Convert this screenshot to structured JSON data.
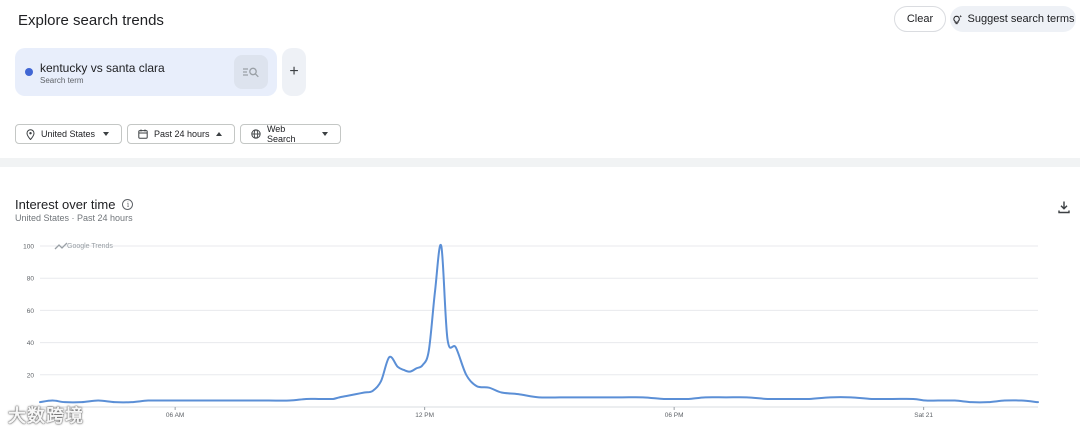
{
  "header": {
    "title": "Explore search trends",
    "clear_label": "Clear",
    "suggest_label": "Suggest search terms"
  },
  "term": {
    "text": "kentucky vs santa clara",
    "subtitle": "Search term",
    "color": "#4066d4",
    "add_symbol": "+"
  },
  "filters": {
    "region": "United States",
    "time": "Past 24 hours",
    "property": "Web Search"
  },
  "panel": {
    "title": "Interest over time",
    "info_symbol": "i",
    "subtitle": "United States · Past 24 hours",
    "branding": "Google Trends"
  },
  "watermark": "大数跨境",
  "chart_data": {
    "type": "line",
    "title": "Interest over time",
    "xlabel": "",
    "ylabel": "",
    "ylim": [
      0,
      100
    ],
    "yticks": [
      20,
      40,
      60,
      80,
      100
    ],
    "xlim": [
      0,
      24
    ],
    "xticks": [
      {
        "x": 3.25,
        "label": "06 AM"
      },
      {
        "x": 9.25,
        "label": "12 PM"
      },
      {
        "x": 15.25,
        "label": "06 PM"
      },
      {
        "x": 21.25,
        "label": "Sat 21"
      }
    ],
    "grid": true,
    "color": "#5b8fd6",
    "series": [
      {
        "name": "kentucky vs santa clara",
        "x": [
          0,
          0.3,
          0.6,
          1,
          1.4,
          1.8,
          2.2,
          2.6,
          3,
          3.5,
          4,
          4.5,
          5,
          5.5,
          6,
          6.4,
          6.7,
          6.9,
          7.05,
          7.2,
          7.4,
          7.6,
          7.8,
          8,
          8.2,
          8.4,
          8.6,
          8.75,
          8.9,
          9.05,
          9.2,
          9.35,
          9.5,
          9.65,
          9.8,
          10,
          10.25,
          10.5,
          10.8,
          11.1,
          11.5,
          12,
          12.5,
          13,
          13.5,
          14,
          14.5,
          15,
          15.3,
          15.6,
          16,
          16.5,
          17,
          17.5,
          18,
          18.5,
          19,
          19.5,
          20,
          20.5,
          21,
          21.3,
          21.6,
          22,
          22.4,
          22.8,
          23.2,
          23.6,
          24
        ],
        "y": [
          3,
          4,
          3,
          3,
          4,
          3,
          3,
          4,
          4,
          4,
          4,
          4,
          4,
          4,
          4,
          5,
          5,
          5,
          5,
          6,
          7,
          8,
          9,
          10,
          16,
          31,
          25,
          23,
          22,
          24,
          26,
          35,
          72,
          100,
          42,
          37,
          20,
          13,
          12,
          9,
          8,
          6,
          6,
          6,
          6,
          6,
          6,
          5,
          5,
          5,
          6,
          6,
          6,
          5,
          5,
          5,
          6,
          6,
          5,
          5,
          5,
          4,
          4,
          4,
          3,
          3,
          4,
          4,
          3
        ]
      }
    ]
  }
}
